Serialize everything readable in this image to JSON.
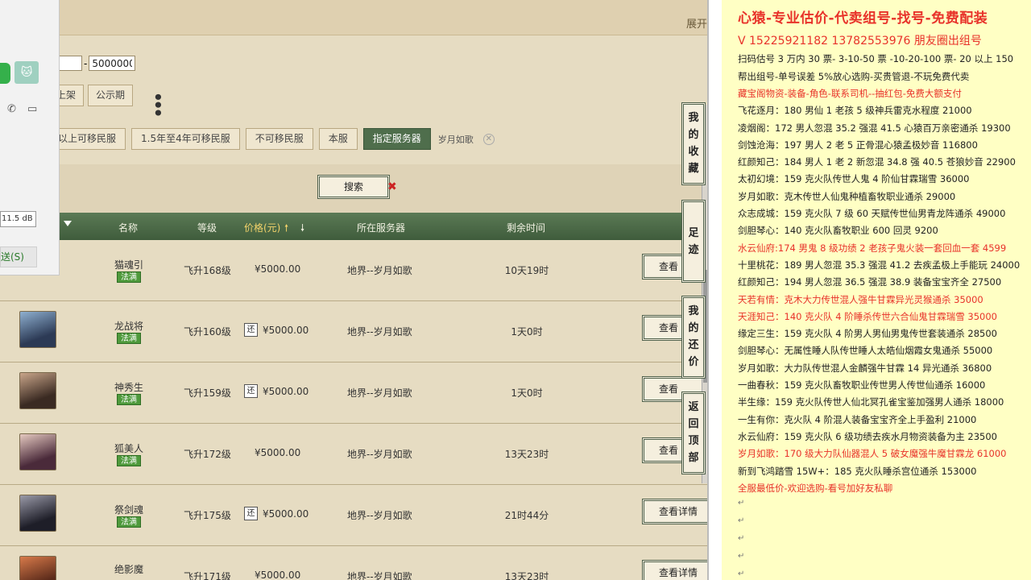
{
  "site": {
    "expand_label": "展开",
    "price_min": "",
    "price_max": "5000000",
    "shelf_tabs": [
      "上架",
      "公示期"
    ],
    "filters": [
      "以上可移民服",
      "1.5年至4年可移民服",
      "不可移民服",
      "本服",
      "指定服务器"
    ],
    "server_tag": "岁月如歌",
    "search_label": "搜索",
    "headers": {
      "name": "名称",
      "level": "等级",
      "price": "价格(元)",
      "server": "所在服务器",
      "time": "剩余时间"
    },
    "rows": [
      {
        "name": "猫魂引",
        "badge": "法满",
        "level": "飞升168级",
        "price": "¥5000.00",
        "huan": "",
        "server": "地界--岁月如歌",
        "time": "10天19时",
        "view": "查看"
      },
      {
        "name": "龙战将",
        "badge": "法满",
        "level": "飞升160级",
        "price": "¥5000.00",
        "huan": "还",
        "server": "地界--岁月如歌",
        "time": "1天0时",
        "view": "查看"
      },
      {
        "name": "神秀生",
        "badge": "法满",
        "level": "飞升159级",
        "price": "¥5000.00",
        "huan": "还",
        "server": "地界--岁月如歌",
        "time": "1天0时",
        "view": "查看"
      },
      {
        "name": "狐美人",
        "badge": "法满",
        "level": "飞升172级",
        "price": "¥5000.00",
        "huan": "",
        "server": "地界--岁月如歌",
        "time": "13天23时",
        "view": "查看"
      },
      {
        "name": "祭剑魂",
        "badge": "法满",
        "level": "飞升175级",
        "price": "¥5000.00",
        "huan": "还",
        "server": "地界--岁月如歌",
        "time": "21时44分",
        "view": "查看详情"
      },
      {
        "name": "绝影魔",
        "badge": "",
        "level": "飞升171级",
        "price": "¥5000.00",
        "huan": "",
        "server": "地界--岁月如歌",
        "time": "13天23时",
        "view": "查看详情"
      }
    ],
    "float_buttons": [
      "我的收藏",
      "足迹",
      "我的还价",
      "返回顶部"
    ]
  },
  "chat": {
    "db_label": "11.5 dB",
    "send_label": "送(S)"
  },
  "notes": {
    "title": "心猿-专业估价-代卖组号-找号-免费配装",
    "lines": [
      {
        "text": "V 15225921182   13782553976 朋友圈出组号",
        "style": "big"
      },
      {
        "text": "扫码估号 3 万内 30 票- 3-10-50 票  -10-20-100 票- 20 以上 150",
        "style": ""
      },
      {
        "text": "帮出组号-单号误差 5%放心选购-买贵管退-不玩免费代卖",
        "style": ""
      },
      {
        "text": "藏宝阁物资-装备-角色-联系司机--抽红包-免费大额支付",
        "style": "red"
      },
      {
        "text": "飞花逐月：180 男仙 1 老孩 5 级神兵雷克水程度 21000",
        "style": ""
      },
      {
        "text": "凌烟阁：172 男人忽混 35.2 强混 41.5 心猿百万亲密通杀 19300",
        "style": ""
      },
      {
        "text": "剑蚀沧海：197 男人 2 老 5 正骨混心猿孟极妙音 116800",
        "style": ""
      },
      {
        "text": "红颜知己：184 男人 1 老 2 新忽混 34.8 强 40.5 苍狼妙音 22900",
        "style": ""
      },
      {
        "text": "太初幻境：159 克火队传世人鬼 4 阶仙甘霖瑞雪 36000",
        "style": ""
      },
      {
        "text": "岁月如歌：克木传世人仙鬼种植畜牧职业通杀 29000",
        "style": ""
      },
      {
        "text": "众志成城：159 克火队 7 级 60 天赋传世仙男青龙阵通杀 49000",
        "style": ""
      },
      {
        "text": "剑胆琴心：140 克火队畜牧职业 600 回灵 9200",
        "style": ""
      },
      {
        "text": "水云仙府:174 男鬼 8 级功绩 2 老孩子鬼火装一套回血一套 4599",
        "style": "red"
      },
      {
        "text": "十里桃花：189 男人忽混 35.3 强混 41.2 去疾孟极上手能玩 24000",
        "style": ""
      },
      {
        "text": "红颜知己：194 男人忽混 36.5 强混 38.9 装备宝宝齐全 27500",
        "style": ""
      },
      {
        "text": "天若有情：克木大力传世混人强牛甘霖异光灵猴通杀 35000",
        "style": "red"
      },
      {
        "text": "天涯知己：140 克火队 4 阶睡杀传世六合仙鬼甘霖瑞雪 35000",
        "style": "red"
      },
      {
        "text": "缘定三生：159 克火队 4 阶男人男仙男鬼传世套装通杀 28500",
        "style": ""
      },
      {
        "text": "剑胆琴心：无属性睡人队传世睡人太皓仙烟霞女鬼通杀 55000",
        "style": ""
      },
      {
        "text": "岁月如歌：大力队传世混人金麟强牛甘霖 14 异光通杀 36800",
        "style": ""
      },
      {
        "text": "一曲春秋：159 克火队畜牧职业传世男人传世仙通杀 16000",
        "style": ""
      },
      {
        "text": "半生缘：159 克火队传世人仙北冥孔雀宝鉴加强男人通杀 18000",
        "style": ""
      },
      {
        "text": "一生有你：克火队 4 阶混人装备宝宝齐全上手盈利 21000",
        "style": ""
      },
      {
        "text": "水云仙府：159 克火队 6 级功绩去疾水月物资装备为主 23500",
        "style": ""
      },
      {
        "text": "岁月如歌：170 级大力队仙器混人 5 破女魔强牛魔甘霖龙 61000",
        "style": "red"
      },
      {
        "text": "新到飞鸿踏雪 15W+：185 克火队睡杀宫位通杀 153000",
        "style": ""
      },
      {
        "text": "全服最低价-欢迎选购-看号加好友私聊",
        "style": "red"
      }
    ]
  }
}
